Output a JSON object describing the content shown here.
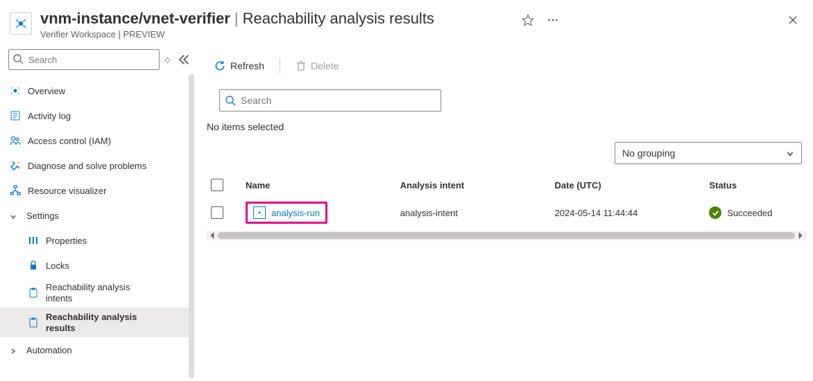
{
  "header": {
    "resource": "vnm-instance/vnet-verifier",
    "page": "Reachability analysis results",
    "subtitle": "Verifier Workspace | PREVIEW"
  },
  "sidebar": {
    "search_placeholder": "Search",
    "items": {
      "overview": "Overview",
      "activity_log": "Activity log",
      "iam": "Access control (IAM)",
      "diagnose": "Diagnose and solve problems",
      "resource_viz": "Resource visualizer",
      "settings": "Settings",
      "properties": "Properties",
      "locks": "Locks",
      "intents": "Reachability analysis intents",
      "results": "Reachability analysis results",
      "automation": "Automation"
    }
  },
  "toolbar": {
    "refresh": "Refresh",
    "delete": "Delete"
  },
  "content": {
    "search_placeholder": "Search",
    "selection_text": "No items selected",
    "grouping_value": "No grouping"
  },
  "table": {
    "columns": {
      "name": "Name",
      "intent": "Analysis intent",
      "date": "Date (UTC)",
      "status": "Status"
    },
    "rows": [
      {
        "name": "analysis-run",
        "intent": "analysis-intent",
        "date": "2024-05-14 11:44:44",
        "status": "Succeeded"
      }
    ]
  }
}
